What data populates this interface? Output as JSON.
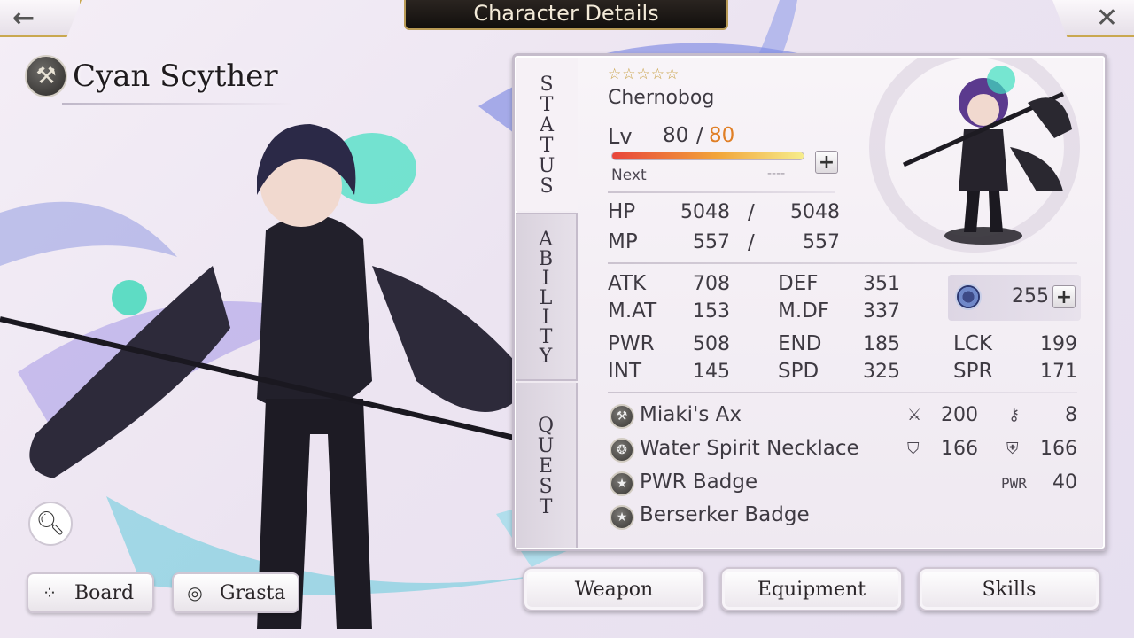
{
  "header": {
    "title": "Character Details",
    "back_icon": "←",
    "close_icon": "✕"
  },
  "character": {
    "name": "Cyan Scyther",
    "weapon_type_icon": "axe-icon",
    "class": "Chernobog",
    "stars": "☆☆☆☆☆",
    "rarity": 5
  },
  "tabs": {
    "status": "STATUS",
    "ability": "ABILITY",
    "quest": "QUEST"
  },
  "level": {
    "label": "Lv",
    "current": "80",
    "separator": "/",
    "max": "80",
    "next_label": "Next",
    "next_value": "----",
    "exp_fraction": 1.0
  },
  "hp": {
    "label": "HP",
    "current": "5048",
    "sep": "/",
    "max": "5048"
  },
  "mp": {
    "label": "MP",
    "current": "557",
    "sep": "/",
    "max": "557"
  },
  "stats": {
    "atk": {
      "label": "ATK",
      "value": "708"
    },
    "def": {
      "label": "DEF",
      "value": "351"
    },
    "mat": {
      "label": "M.AT",
      "value": "153"
    },
    "mdf": {
      "label": "M.DF",
      "value": "337"
    },
    "pwr": {
      "label": "PWR",
      "value": "508"
    },
    "end": {
      "label": "END",
      "value": "185"
    },
    "lck": {
      "label": "LCK",
      "value": "199"
    },
    "int": {
      "label": "INT",
      "value": "145"
    },
    "spd": {
      "label": "SPD",
      "value": "325"
    },
    "spr": {
      "label": "SPR",
      "value": "171"
    }
  },
  "spirit": {
    "value": "255",
    "icon": "spirit-orb-icon"
  },
  "equipment": [
    {
      "name": "Miaki's Ax",
      "icon": "axe-icon",
      "stat1": "200",
      "stat1_icon": "sword-icon",
      "stat2": "8",
      "stat2_icon": "wand-icon"
    },
    {
      "name": "Water Spirit Necklace",
      "icon": "necklace-icon",
      "stat1": "166",
      "stat1_icon": "shield-icon",
      "stat2": "166",
      "stat2_icon": "shield-plus-icon"
    },
    {
      "name": "PWR Badge",
      "icon": "badge-icon",
      "stat_tag": "PWR",
      "stat": "40"
    },
    {
      "name": "Berserker Badge",
      "icon": "badge-icon"
    }
  ],
  "buttons": {
    "board": "Board",
    "grasta": "Grasta",
    "weapon": "Weapon",
    "equipment": "Equipment",
    "skills": "Skills"
  },
  "colors": {
    "level_max": "#e07f26",
    "accent_gold": "#c9a84f",
    "panel_border": "#c5bccb"
  }
}
